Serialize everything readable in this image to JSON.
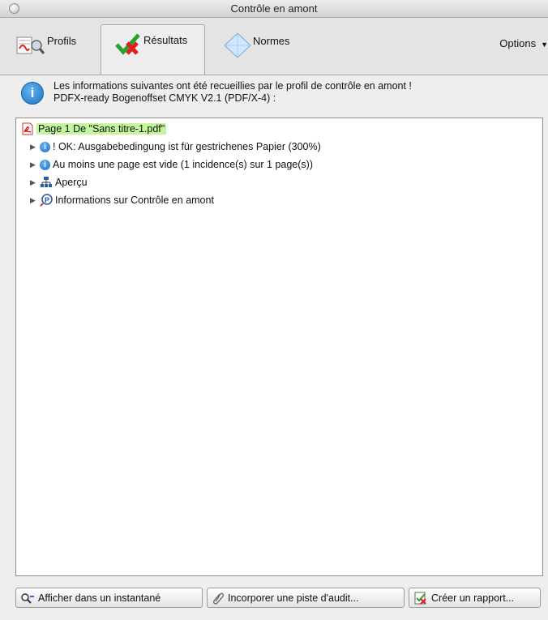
{
  "window": {
    "title": "Contrôle en amont"
  },
  "tabs": [
    {
      "label": "Profils",
      "icon": "profiles-icon",
      "active": false
    },
    {
      "label": "Résultats",
      "icon": "results-check-icon",
      "active": true
    },
    {
      "label": "Normes",
      "icon": "normes-diamond-icon",
      "active": false
    }
  ],
  "options_label": "Options",
  "info": {
    "line1": "Les informations suivantes ont été recueillies par le profil de contrôle en amont !",
    "line2": "PDFX-ready Bogenoffset CMYK V2.1 (PDF/X-4) :"
  },
  "tree": {
    "root": "Page 1 De \"Sans titre-1.pdf\"",
    "items": [
      {
        "label": "! OK: Ausgabebedingung ist für gestrichenes Papier (300%)",
        "icon": "info-icon"
      },
      {
        "label": "Au moins une page est vide (1 incidence(s) sur 1 page(s))",
        "icon": "info-icon"
      },
      {
        "label": "Aperçu",
        "icon": "overview-icon"
      },
      {
        "label": "Informations sur Contrôle en amont",
        "icon": "preflight-info-icon"
      }
    ]
  },
  "buttons": {
    "snapshot": "Afficher dans un instantané",
    "audit": "Incorporer une piste d'audit...",
    "report": "Créer un rapport..."
  }
}
